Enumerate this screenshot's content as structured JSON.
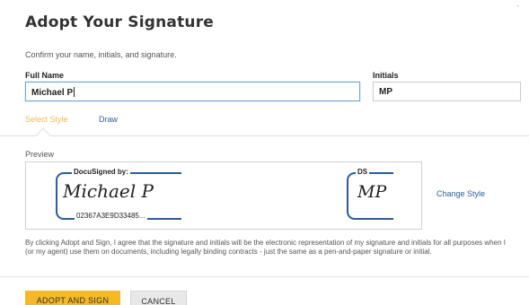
{
  "dialog": {
    "title": "Adopt Your Signature",
    "subtitle": "Confirm your name, initials, and signature.",
    "close_glyph": "ˉ"
  },
  "form": {
    "full_name_label": "Full Name",
    "full_name_value": "Michael P",
    "initials_label": "Initials",
    "initials_value": "MP"
  },
  "tabs": [
    {
      "label": "Select Style",
      "active": true
    },
    {
      "label": "Draw",
      "active": false
    }
  ],
  "preview": {
    "label": "Preview",
    "signature_header": "DocuSigned by:",
    "signature_text": "Michael P",
    "signature_id": "02367A3E9D33485...",
    "initials_header": "DS",
    "initials_text": "MP",
    "change_style_label": "Change Style"
  },
  "legal_text": "By clicking Adopt and Sign, I agree that the signature and initials will be the electronic representation of my signature and initials for all purposes when I (or my agent) use them on documents, including legally binding contracts - just the same as a pen-and-paper signature or initial.",
  "actions": {
    "adopt_label": "ADOPT AND SIGN",
    "cancel_label": "CANCEL"
  },
  "colors": {
    "accent_tab": "#f2b84b",
    "link": "#2a5f9e",
    "primary_button": "#f5b826",
    "signature_frame": "#2b5c9e"
  }
}
